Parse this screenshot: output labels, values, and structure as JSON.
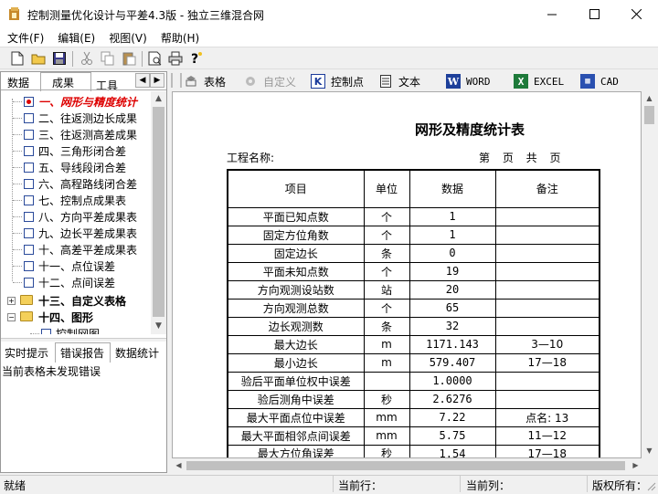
{
  "window": {
    "title": "控制测量优化设计与平差4.3版 - 独立三维混合网",
    "minimize_glyph": "—",
    "maximize_glyph": "☐",
    "close_glyph": "✕"
  },
  "menu": [
    {
      "label": "文件(F)"
    },
    {
      "label": "编辑(E)"
    },
    {
      "label": "视图(V)"
    },
    {
      "label": "帮助(H)"
    }
  ],
  "toolbar": {
    "icons": [
      "new-file-icon",
      "open-folder-icon",
      "save-icon",
      "cut-icon",
      "copy-icon",
      "paste-icon",
      "print-preview-icon",
      "print-icon",
      "help-icon"
    ]
  },
  "left_tabs": [
    "数据",
    "成果",
    "工具"
  ],
  "tree": [
    {
      "label": "一、网形与精度统计",
      "selected": true
    },
    {
      "label": "二、往返测边长成果"
    },
    {
      "label": "三、往返测高差成果"
    },
    {
      "label": "四、三角形闭合差"
    },
    {
      "label": "五、导线段闭合差"
    },
    {
      "label": "六、高程路线闭合差"
    },
    {
      "label": "七、控制点成果表"
    },
    {
      "label": "八、方向平差成果表"
    },
    {
      "label": "九、边长平差成果表"
    },
    {
      "label": "十、高差平差成果表"
    },
    {
      "label": "十一、点位误差"
    },
    {
      "label": "十二、点间误差"
    },
    {
      "label": "十三、自定义表格",
      "folder": true,
      "expand": "+"
    },
    {
      "label": "十四、图形",
      "folder": true,
      "expand": "−"
    },
    {
      "label": "控制网图",
      "child": true
    }
  ],
  "bottom_tabs": [
    "实时提示",
    "错误报告",
    "数据统计"
  ],
  "message": "当前表格未发现错误",
  "right_toolbar": [
    {
      "label": "表格",
      "icon": "table-icon",
      "disabled": false
    },
    {
      "label": "自定义",
      "icon": "custom-icon",
      "disabled": true
    },
    {
      "label": "控制点",
      "icon": "control-point-icon",
      "disabled": false
    },
    {
      "label": "文本",
      "icon": "text-file-icon",
      "disabled": false
    },
    {
      "label": "WORD",
      "icon": "word-icon",
      "disabled": false
    },
    {
      "label": "EXCEL",
      "icon": "excel-icon",
      "disabled": false
    },
    {
      "label": "CAD",
      "icon": "cad-icon",
      "disabled": false
    }
  ],
  "document": {
    "title": "网形及精度统计表",
    "project_label": "工程名称:",
    "page_info": "第 页 共 页",
    "columns": [
      "项目",
      "单位",
      "数据",
      "备注"
    ],
    "rows": [
      [
        "平面已知点数",
        "个",
        "1",
        ""
      ],
      [
        "固定方位角数",
        "个",
        "1",
        ""
      ],
      [
        "固定边长",
        "条",
        "0",
        ""
      ],
      [
        "平面未知点数",
        "个",
        "19",
        ""
      ],
      [
        "方向观测设站数",
        "站",
        "20",
        ""
      ],
      [
        "方向观测总数",
        "个",
        "65",
        ""
      ],
      [
        "边长观测数",
        "条",
        "32",
        ""
      ],
      [
        "最大边长",
        "m",
        "1171.143",
        "3—10"
      ],
      [
        "最小边长",
        "m",
        "579.407",
        "17—18"
      ],
      [
        "验后平面单位权中误差",
        "",
        "1.0000",
        ""
      ],
      [
        "验后测角中误差",
        "秒",
        "2.6276",
        ""
      ],
      [
        "最大平面点位中误差",
        "mm",
        "7.22",
        "点名: 13"
      ],
      [
        "最大平面相邻点间误差",
        "mm",
        "5.75",
        "11—12"
      ],
      [
        "最大方位角误差",
        "秒",
        "1.54",
        "17—18"
      ]
    ]
  },
  "status": {
    "ready": "就绪",
    "row_label": "当前行：",
    "col_label": "当前列：",
    "copyright_label": "版权所有："
  }
}
